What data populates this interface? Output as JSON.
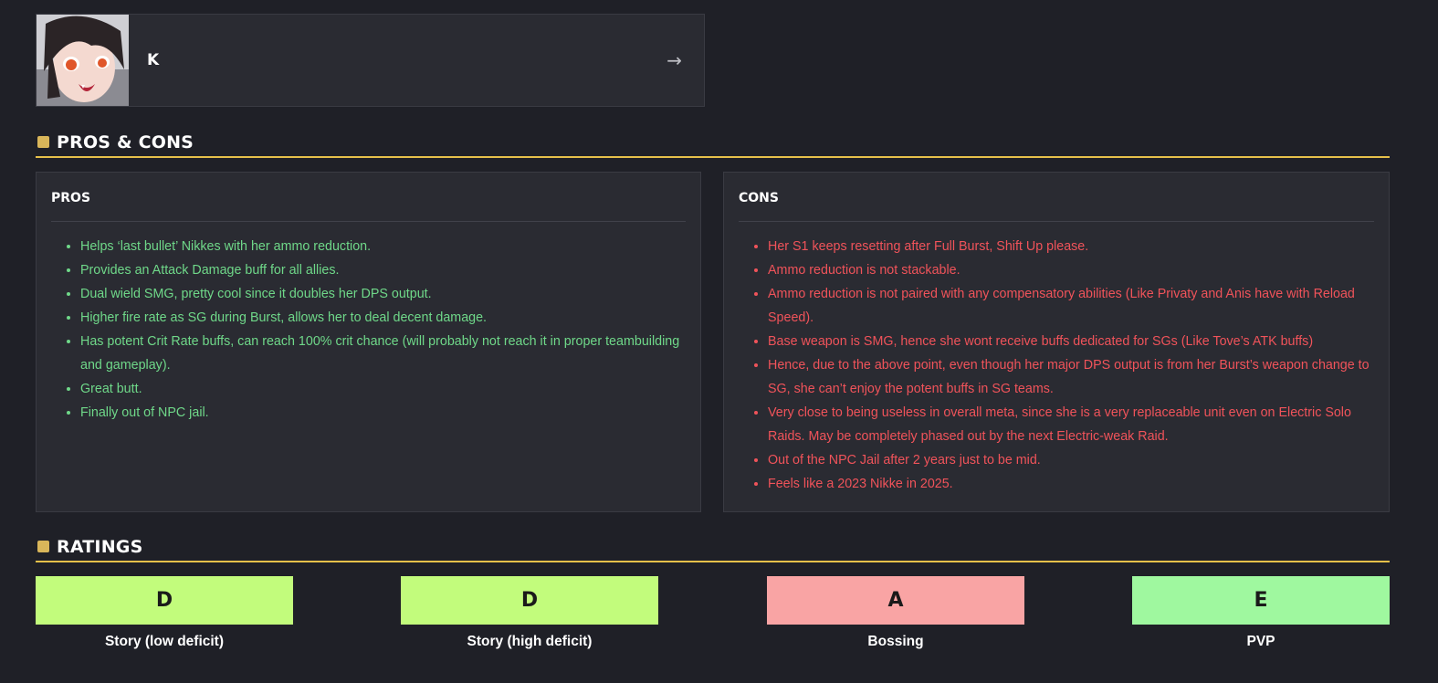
{
  "character": {
    "name": "K",
    "arrow": "→"
  },
  "sections": {
    "pros_cons_title": "PROS & CONS",
    "ratings_title": "RATINGS"
  },
  "pros": {
    "title": "PROS",
    "items": [
      "Helps ‘last bullet’ Nikkes with her ammo reduction.",
      "Provides an Attack Damage buff for all allies.",
      "Dual wield SMG, pretty cool since it doubles her DPS output.",
      "Higher fire rate as SG during Burst, allows her to deal decent damage.",
      "Has potent Crit Rate buffs, can reach 100% crit chance (will probably not reach it in proper teambuilding and gameplay).",
      "Great butt.",
      "Finally out of NPC jail."
    ]
  },
  "cons": {
    "title": "CONS",
    "items": [
      "Her S1 keeps resetting after Full Burst, Shift Up please.",
      "Ammo reduction is not stackable.",
      "Ammo reduction is not paired with any compensatory abilities (Like Privaty and Anis have with Reload Speed).",
      "Base weapon is SMG, hence she wont receive buffs dedicated for SGs (Like Tove’s ATK buffs)",
      "Hence, due to the above point, even though her major DPS output is from her Burst’s weapon change to SG, she can’t enjoy the potent buffs in SG teams.",
      "Very close to being useless in overall meta, since she is a very replaceable unit even on Electric Solo Raids. May be completely phased out by the next Electric-weak Raid.",
      "Out of the NPC Jail after 2 years just to be mid.",
      "Feels like a 2023 Nikke in 2025."
    ]
  },
  "ratings": [
    {
      "grade": "D",
      "label": "Story (low deficit)",
      "color": "#c2fc7c"
    },
    {
      "grade": "D",
      "label": "Story (high deficit)",
      "color": "#c2fc7c"
    },
    {
      "grade": "A",
      "label": "Bossing",
      "color": "#f9a4a4"
    },
    {
      "grade": "E",
      "label": "PVP",
      "color": "#9ff89f"
    }
  ],
  "colors": {
    "accent": "#e6c04a",
    "pros_text": "#6fd889",
    "cons_text": "#f0535a",
    "background": "#1f2027",
    "panel": "#2a2b32"
  }
}
